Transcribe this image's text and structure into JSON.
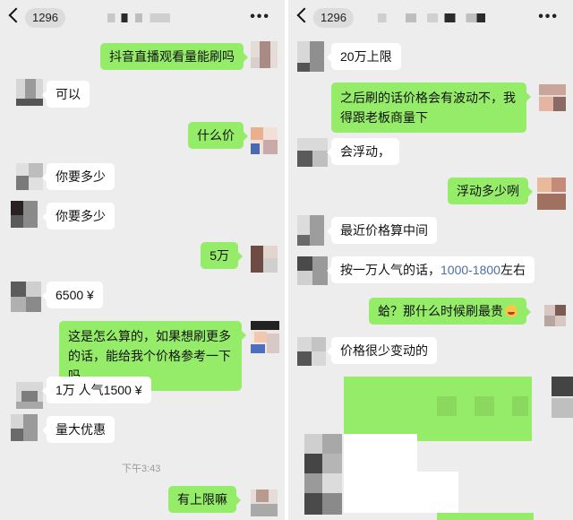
{
  "header": {
    "count_badge": "1296",
    "more_label": "•••"
  },
  "left": {
    "messages": [
      {
        "side": "out",
        "text": "抖音直播观看量能刷吗"
      },
      {
        "side": "in",
        "text": "可以"
      },
      {
        "side": "out",
        "text": "什么价"
      },
      {
        "side": "in",
        "text": "你要多少"
      },
      {
        "side": "in",
        "text": "你要多少"
      },
      {
        "side": "out",
        "text": "5万"
      },
      {
        "side": "in",
        "text": "6500 ¥"
      },
      {
        "side": "out",
        "text": "这是怎么算的，如果想刷更多的话，能给我个价格参考一下吗"
      },
      {
        "side": "in",
        "text": "1万 人气1500 ¥"
      },
      {
        "side": "in",
        "text": "量大优惠"
      },
      {
        "side": "out",
        "text": "有上限嘛"
      }
    ],
    "timestamp": "下午3:43"
  },
  "right": {
    "messages": [
      {
        "side": "in",
        "text": "20万上限"
      },
      {
        "side": "out",
        "text": "之后刷的话价格会有波动不，我得跟老板商量下"
      },
      {
        "side": "in",
        "text": "会浮动，"
      },
      {
        "side": "out",
        "text": "浮动多少咧"
      },
      {
        "side": "in",
        "text": "最近价格算中间"
      },
      {
        "side": "in",
        "text_before": "按一万人气的话，",
        "text_highlight": "1000-1800",
        "text_after": "左右"
      },
      {
        "side": "out",
        "text": "蛤？那什么时候刷最贵"
      },
      {
        "side": "in",
        "text": "价格很少变动的"
      }
    ]
  },
  "colors": {
    "outgoing_bubble": "#95ec69",
    "incoming_bubble": "#ffffff",
    "background": "#ededed",
    "highlight": "#4a6fa5"
  }
}
